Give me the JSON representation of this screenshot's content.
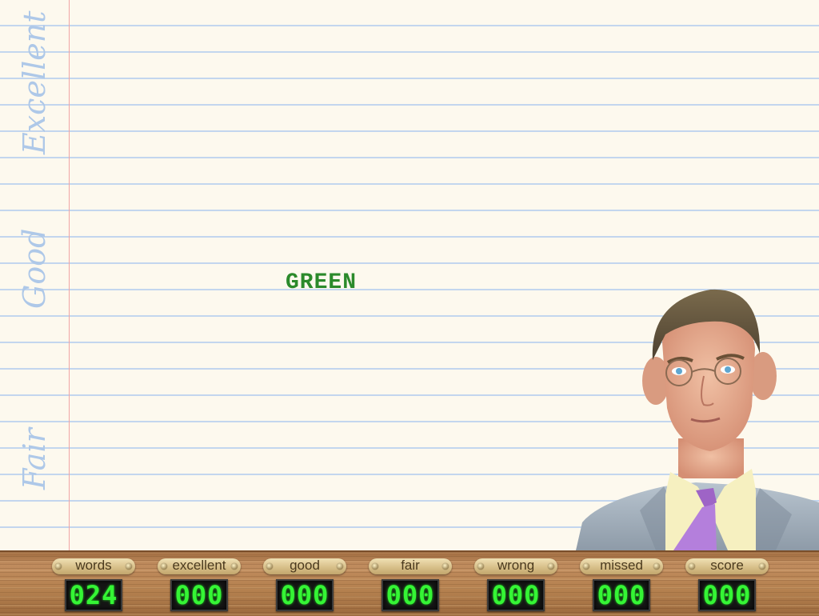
{
  "paper": {
    "zones": {
      "excellent": "Excellent",
      "good": "Good",
      "fair": "Fair"
    },
    "word": "GREEN",
    "word_color": "#2b8a2b"
  },
  "teacher": {
    "icon": "teacher-portrait"
  },
  "scoreboard": {
    "counters": [
      {
        "label": "words",
        "value": "024"
      },
      {
        "label": "excellent",
        "value": "000"
      },
      {
        "label": "good",
        "value": "000"
      },
      {
        "label": "fair",
        "value": "000"
      },
      {
        "label": "wrong",
        "value": "000"
      },
      {
        "label": "missed",
        "value": "000"
      },
      {
        "label": "score",
        "value": "000"
      }
    ],
    "digit_color": "#35f535"
  }
}
